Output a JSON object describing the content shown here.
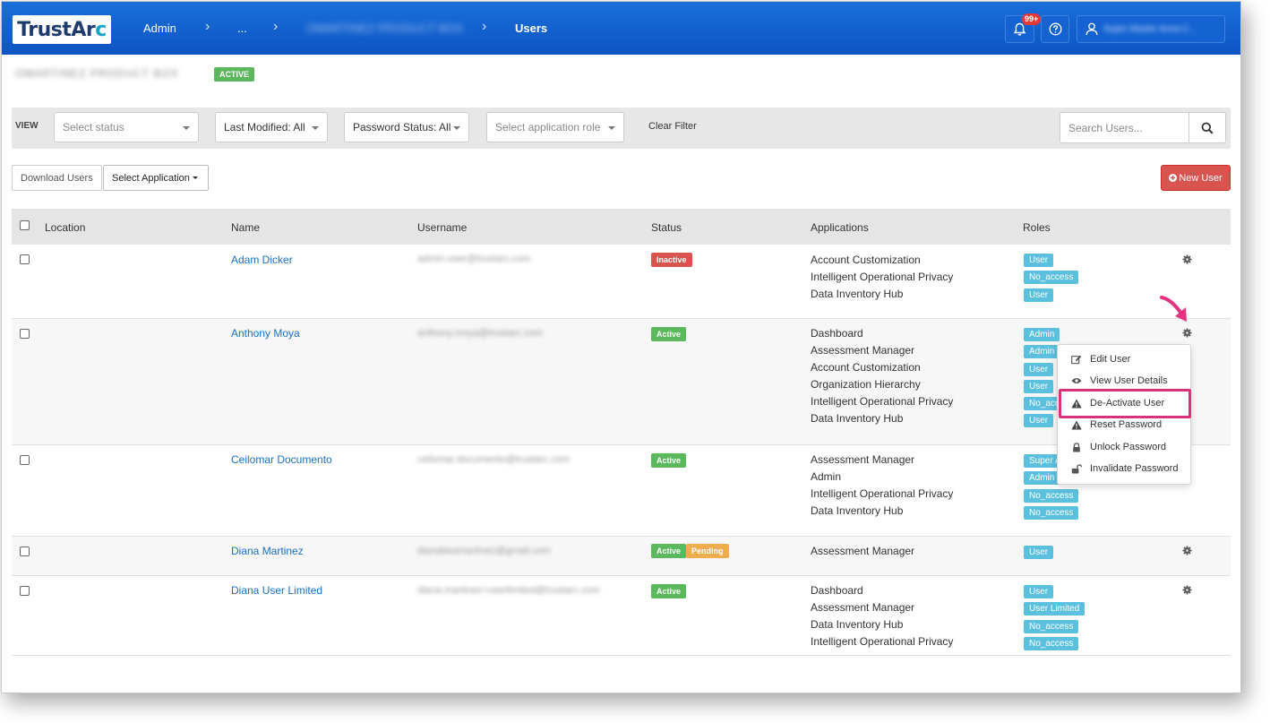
{
  "header": {
    "logo_main": "TrustAr",
    "logo_accent": "c",
    "breadcrumb": [
      "Admin",
      "...",
      "OMARTINEZ PRODUCT BOX",
      "Users"
    ],
    "notification_count": "99+",
    "user_name": "Super Master Anna C..."
  },
  "org": {
    "name": "OMARTINEZ PRODUCT BOX",
    "status": "ACTIVE"
  },
  "filters": {
    "view_label": "VIEW",
    "status_placeholder": "Select status",
    "last_modified": "Last Modified: All",
    "password_status": "Password Status: All",
    "role_placeholder": "Select application role",
    "clear_filter": "Clear Filter",
    "search_placeholder": "Search Users..."
  },
  "actions": {
    "download_users": "Download Users",
    "select_application": "Select Application",
    "new_user": "New User"
  },
  "table": {
    "headers": [
      "Location",
      "Name",
      "Username",
      "Status",
      "Applications",
      "Roles"
    ],
    "rows": [
      {
        "name": "Adam Dicker",
        "username": "admin-user@trustarc.com",
        "status": [
          "Inactive"
        ],
        "applications": [
          "Account Customization",
          "Intelligent Operational Privacy",
          "Data Inventory Hub"
        ],
        "roles": [
          "User",
          "No_access",
          "User"
        ]
      },
      {
        "name": "Anthony Moya",
        "username": "anthony.moya@trustarc.com",
        "status": [
          "Active"
        ],
        "applications": [
          "Dashboard",
          "Assessment Manager",
          "Account Customization",
          "Organization Hierarchy",
          "Intelligent Operational Privacy",
          "Data Inventory Hub"
        ],
        "roles": [
          "Admin",
          "Admin",
          "User",
          "User",
          "No_access",
          "User"
        ]
      },
      {
        "name": "Ceilomar Documento",
        "username": "ceilomar.documento@trustarc.com",
        "status": [
          "Active"
        ],
        "applications": [
          "Assessment Manager",
          "Admin",
          "Intelligent Operational Privacy",
          "Data Inventory Hub"
        ],
        "roles": [
          "Super Admin",
          "Admin",
          "No_access",
          "No_access"
        ]
      },
      {
        "name": "Diana Martinez",
        "username": "dianabeamartinez@gmail.com",
        "status": [
          "Active",
          "Pending"
        ],
        "applications": [
          "Assessment Manager"
        ],
        "roles": [
          "User"
        ]
      },
      {
        "name": "Diana User Limited",
        "username": "diana.martinez+userlimited@trustarc.com",
        "status": [
          "Active"
        ],
        "applications": [
          "Dashboard",
          "Assessment Manager",
          "Data Inventory Hub",
          "Intelligent Operational Privacy"
        ],
        "roles": [
          "User",
          "User Limited",
          "No_access",
          "No_access"
        ]
      }
    ]
  },
  "row_menu": {
    "items": [
      "Edit User",
      "View User Details",
      "De-Activate User",
      "Reset Password",
      "Unlock Password",
      "Invalidate Password"
    ],
    "highlighted": "De-Activate User"
  },
  "colors": {
    "header_blue": "#0d55c2",
    "link_blue": "#1a6fc4",
    "active_green": "#5cb85c",
    "inactive_red": "#d9534f",
    "pending_orange": "#f0ad4e",
    "role_cyan": "#5bc0de",
    "highlight_pink": "#d6337a"
  }
}
